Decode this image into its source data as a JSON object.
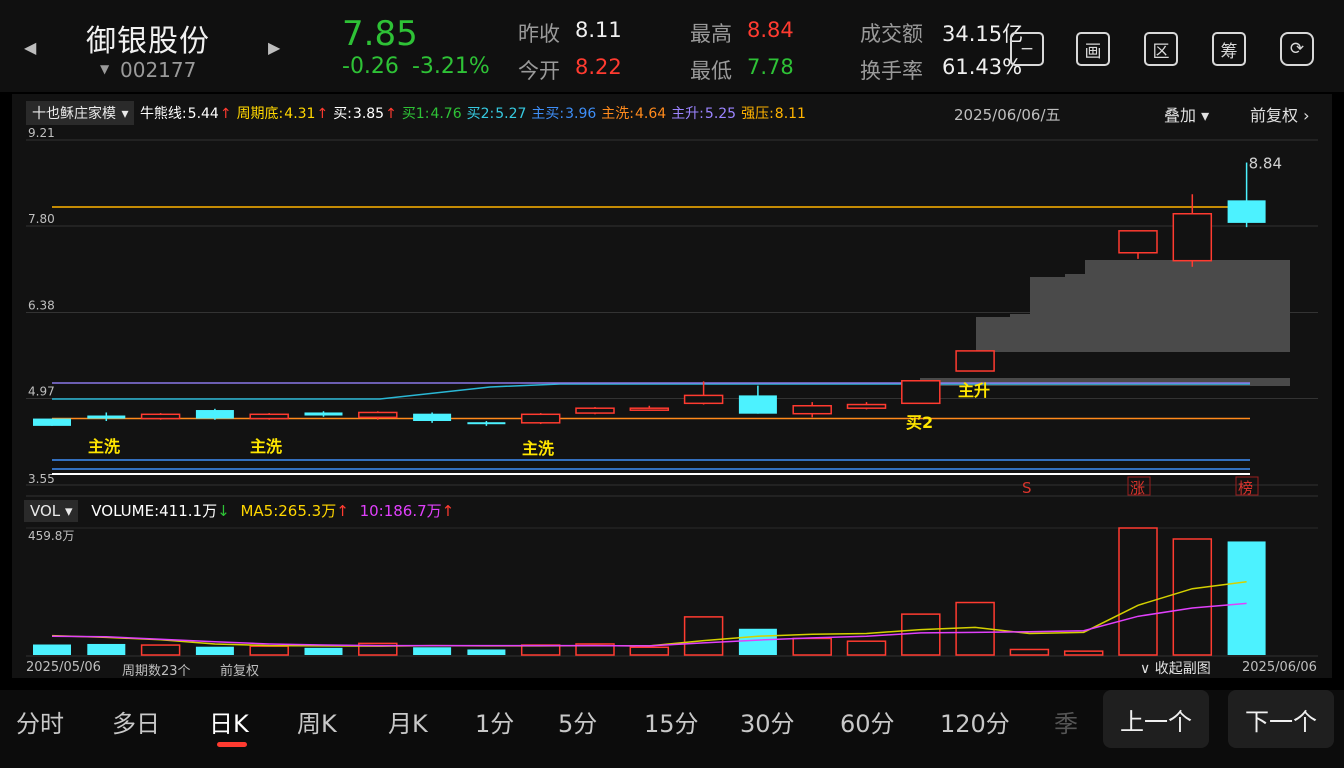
{
  "header": {
    "stock_name": "御银股份",
    "stock_code": "002177",
    "price": "7.85",
    "change": "-0.26",
    "change_pct": "-3.21%",
    "prev_close_label": "昨收",
    "prev_close": "8.11",
    "open_label": "今开",
    "open": "8.22",
    "high_label": "最高",
    "high": "8.84",
    "low_label": "最低",
    "low": "7.78",
    "turnover_label": "成交额",
    "turnover": "34.15亿",
    "turnover_rate_label": "换手率",
    "turnover_rate": "61.43%",
    "toolbar_icons": [
      {
        "name": "minus-icon",
        "glyph": "−"
      },
      {
        "name": "draw-icon",
        "glyph": "画"
      },
      {
        "name": "range-icon",
        "glyph": "区"
      },
      {
        "name": "chips-icon",
        "glyph": "筹"
      },
      {
        "name": "rotate-screen-icon",
        "glyph": "⟳"
      }
    ]
  },
  "indicator_bar": {
    "selector": "十也稣庄家模",
    "items": [
      {
        "label": "牛熊线:",
        "value": "5.44",
        "arrow": "↑",
        "color": "#ffffff"
      },
      {
        "label": "周期底:",
        "value": "4.31",
        "arrow": "↑",
        "color": "#ffd600"
      },
      {
        "label": "买:",
        "value": "3.85",
        "arrow": "↑",
        "color": "#ffffff"
      },
      {
        "label": "买1:",
        "value": "4.76",
        "arrow": "",
        "color": "#2ec236"
      },
      {
        "label": "买2:",
        "value": "5.27",
        "arrow": "",
        "color": "#36c9e0"
      },
      {
        "label": "主买:",
        "value": "3.96",
        "arrow": "",
        "color": "#3e8ef7"
      },
      {
        "label": "主洗:",
        "value": "4.64",
        "arrow": "",
        "color": "#ff8a1c"
      },
      {
        "label": "主升:",
        "value": "5.25",
        "arrow": "",
        "color": "#9b84ff"
      },
      {
        "label": "强压:",
        "value": "8.11",
        "arrow": "",
        "color": "#ffb300"
      }
    ],
    "date": "2025/06/06/五",
    "overlay_label": "叠加",
    "adjust_label": "前复权"
  },
  "main_chart": {
    "y_labels": [
      "9.21",
      "7.80",
      "6.38",
      "4.97",
      "3.55"
    ],
    "high_label": "8.84",
    "signals": [
      "主洗",
      "主洗",
      "主洗",
      "买2",
      "主升"
    ],
    "bottom_marks": [
      "S",
      "涨",
      "榜"
    ]
  },
  "volume_bar": {
    "selector": "VOL",
    "volume_label": "VOLUME:",
    "volume": "411.1万",
    "volume_arrow": "↓",
    "ma5_label": "MA5:",
    "ma5": "265.3万",
    "ma5_arrow": "↑",
    "ma10_label": "10:",
    "ma10": "186.7万",
    "ma10_arrow": "↑",
    "max_label": "459.8万"
  },
  "footer": {
    "start_date": "2025/05/06",
    "period_count": "周期数23个",
    "adjust": "前复权",
    "collapse": "∨ 收起副图",
    "end_date": "2025/06/06"
  },
  "tabs": [
    "分时",
    "多日",
    "日K",
    "周K",
    "月K",
    "1分",
    "5分",
    "15分",
    "30分",
    "60分",
    "120分",
    "季"
  ],
  "active_tab": "日K",
  "pager": {
    "prev": "上一个",
    "next": "下一个"
  },
  "colors": {
    "up": "#ff3b30",
    "down": "#4cf2ff",
    "price_down": "#2ec236"
  },
  "chart_data": {
    "type": "candlestick",
    "ylim": [
      3.55,
      9.21
    ],
    "candles": [
      {
        "o": 4.64,
        "c": 4.52,
        "h": 4.64,
        "l": 4.52
      },
      {
        "o": 4.69,
        "c": 4.64,
        "h": 4.74,
        "l": 4.6
      },
      {
        "o": 4.64,
        "c": 4.71,
        "h": 4.73,
        "l": 4.62
      },
      {
        "o": 4.78,
        "c": 4.64,
        "h": 4.8,
        "l": 4.62
      },
      {
        "o": 4.64,
        "c": 4.71,
        "h": 4.73,
        "l": 4.62
      },
      {
        "o": 4.74,
        "c": 4.69,
        "h": 4.76,
        "l": 4.67
      },
      {
        "o": 4.66,
        "c": 4.74,
        "h": 4.76,
        "l": 4.62
      },
      {
        "o": 4.72,
        "c": 4.6,
        "h": 4.74,
        "l": 4.57
      },
      {
        "o": 4.58,
        "c": 4.55,
        "h": 4.6,
        "l": 4.52
      },
      {
        "o": 4.57,
        "c": 4.71,
        "h": 4.73,
        "l": 4.55
      },
      {
        "o": 4.73,
        "c": 4.81,
        "h": 4.83,
        "l": 4.71
      },
      {
        "o": 4.81,
        "c": 4.81,
        "h": 4.85,
        "l": 4.77
      },
      {
        "o": 4.89,
        "c": 5.02,
        "h": 5.25,
        "l": 4.87
      },
      {
        "o": 5.02,
        "c": 4.72,
        "h": 5.18,
        "l": 4.72
      },
      {
        "o": 4.72,
        "c": 4.85,
        "h": 4.91,
        "l": 4.66
      },
      {
        "o": 4.81,
        "c": 4.87,
        "h": 4.91,
        "l": 4.79
      },
      {
        "o": 4.89,
        "c": 5.26,
        "h": 5.26,
        "l": 4.89
      },
      {
        "o": 5.42,
        "c": 5.75,
        "h": 5.75,
        "l": 5.42
      },
      {
        "o": 0,
        "c": 0,
        "h": 0,
        "l": 0
      },
      {
        "o": 0,
        "c": 0,
        "h": 0,
        "l": 0
      },
      {
        "o": 7.36,
        "c": 7.72,
        "h": 7.72,
        "l": 7.26
      },
      {
        "o": 7.23,
        "c": 8.0,
        "h": 8.32,
        "l": 7.13
      },
      {
        "o": 8.22,
        "c": 7.85,
        "h": 8.84,
        "l": 7.78
      }
    ],
    "horizontal_lines": [
      {
        "name": "强压",
        "value": 8.11,
        "color": "#ffb300"
      },
      {
        "name": "主洗",
        "value": 4.64,
        "color": "#ff8a1c"
      },
      {
        "name": "主买",
        "value": 3.96,
        "color": "#3e8ef7"
      }
    ],
    "volume_ylim": [
      0,
      459.8
    ],
    "volumes": [
      38,
      40,
      36,
      30,
      32,
      26,
      42,
      28,
      20,
      36,
      40,
      28,
      138,
      95,
      60,
      50,
      148,
      190,
      20,
      14,
      459.8,
      420,
      411.1
    ],
    "ma5": [
      70,
      64,
      55,
      40,
      34,
      33,
      32,
      34,
      33,
      33,
      34,
      33,
      52,
      68,
      75,
      78,
      92,
      100,
      78,
      82,
      180,
      240,
      265.3
    ],
    "ma10": [
      68,
      66,
      57,
      48,
      40,
      36,
      34,
      34,
      34,
      34,
      34,
      33,
      44,
      54,
      62,
      68,
      80,
      82,
      84,
      88,
      140,
      170,
      186.7
    ]
  }
}
